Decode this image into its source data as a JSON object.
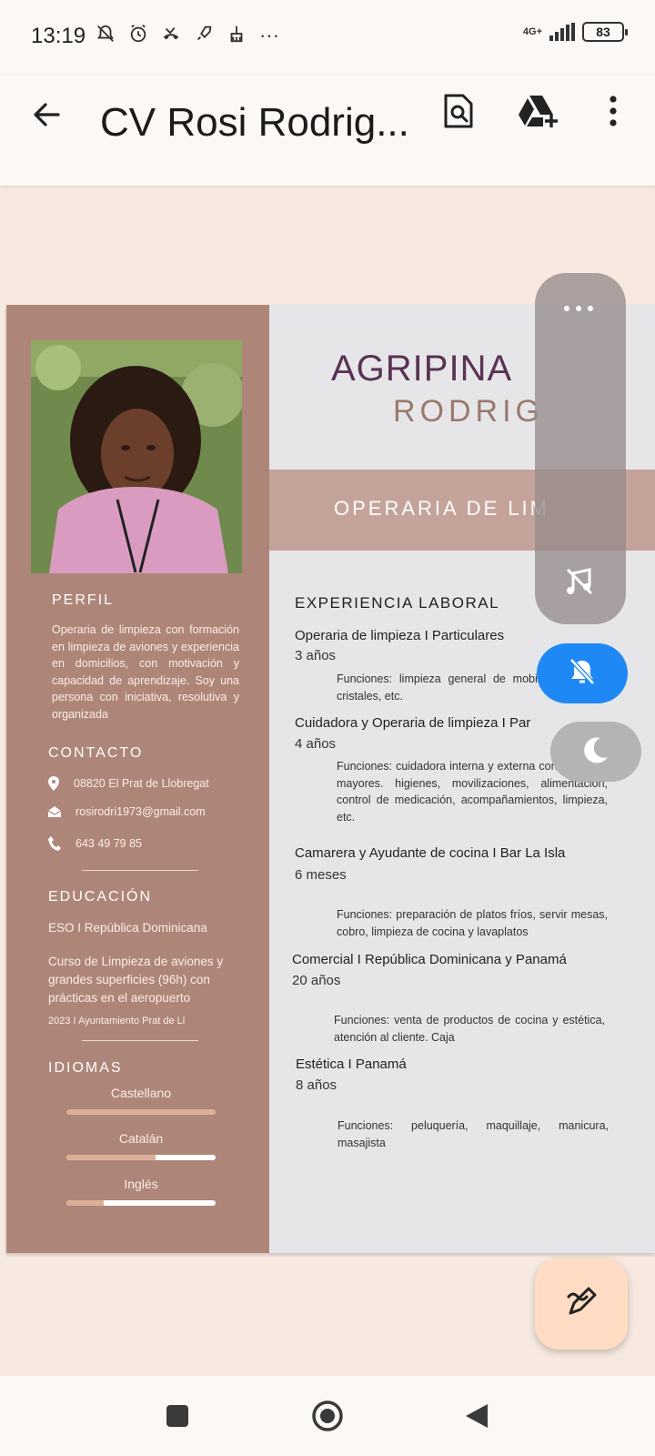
{
  "status_bar": {
    "time": "13:19",
    "more_label": "···",
    "network_label": "4G+",
    "battery_level": "83"
  },
  "app_bar": {
    "title": "CV Rosi Rodrig...",
    "icons": [
      "arrow-back-icon",
      "document-search-icon",
      "drive-add-icon",
      "more-vert-icon"
    ]
  },
  "document": {
    "name_first": "AGRIPINA",
    "name_last": "RODRIG",
    "role": "OPERARIA DE LIM",
    "profile": {
      "heading": "PERFIL",
      "text": "Operaria de limpieza con formación en limpieza de aviones y experiencia en domicilios, con motivación y capacidad de aprendizaje. Soy una persona con iniciativa, resolutiva y organizada"
    },
    "contact": {
      "heading": "CONTACTO",
      "address": "08820 El Prat de Llobregat",
      "email": "rosirodri1973@gmail.com",
      "phone": "643 49 79 85"
    },
    "education": {
      "heading": "EDUCACIÓN",
      "item1": "ESO I República Dominicana",
      "item2": "Curso de Limpieza de aviones y grandes superficies (96h) con prácticas en el aeropuerto",
      "item2_meta": "2023 I Ayuntamiento Prat de Ll"
    },
    "languages": {
      "heading": "IDIOMAS",
      "items": [
        {
          "name": "Castellano",
          "level": 1.0
        },
        {
          "name": "Catalán",
          "level": 0.6
        },
        {
          "name": "Inglés",
          "level": 0.25
        }
      ]
    },
    "experience": {
      "heading": "EXPERIENCIA LABORAL",
      "jobs": [
        {
          "title": "Operaria de limpieza I Particulares",
          "duration": "3 años",
          "desc": "Funciones: limpieza general de mobiliario, cocina, cristales, etc."
        },
        {
          "title": "Cuidadora y Operaria de limpieza I Par",
          "duration": "4 años",
          "desc": "Funciones: cuidadora interna y externa con personas mayores. higienes, movilizaciones, alimentación, control de medicación, acompañamientos, limpieza, etc."
        },
        {
          "title": "Camarera y Ayudante de cocina I Bar La Isla",
          "duration": "6 meses",
          "desc": "Funciones: preparación de platos fríos, servir mesas, cobro, limpieza de cocina y lavaplatos"
        },
        {
          "title": "Comercial I República Dominicana y Panamá",
          "duration": "20 años",
          "desc": "Funciones: venta de productos de cocina y estética, atención al cliente. Caja"
        },
        {
          "title": "Estética I  Panamá",
          "duration": "8 años",
          "desc": "Funciones: peluquería, maquillaje, manicura, masajista"
        }
      ]
    }
  },
  "floating_panel": {
    "icons": [
      "more-horiz-icon",
      "music-off-icon",
      "bell-off-icon",
      "moon-icon"
    ]
  },
  "fab": {
    "icon": "edit-sparkle-icon"
  },
  "nav_bar": {
    "icons": [
      "recents-icon",
      "home-icon",
      "back-triangle-icon"
    ]
  },
  "colors": {
    "sidebar": "#ae8679",
    "role_band": "#c4a39a",
    "name_primary": "#5a3354",
    "accent_blue": "#1e88f5",
    "fab": "#ffdcc3"
  }
}
